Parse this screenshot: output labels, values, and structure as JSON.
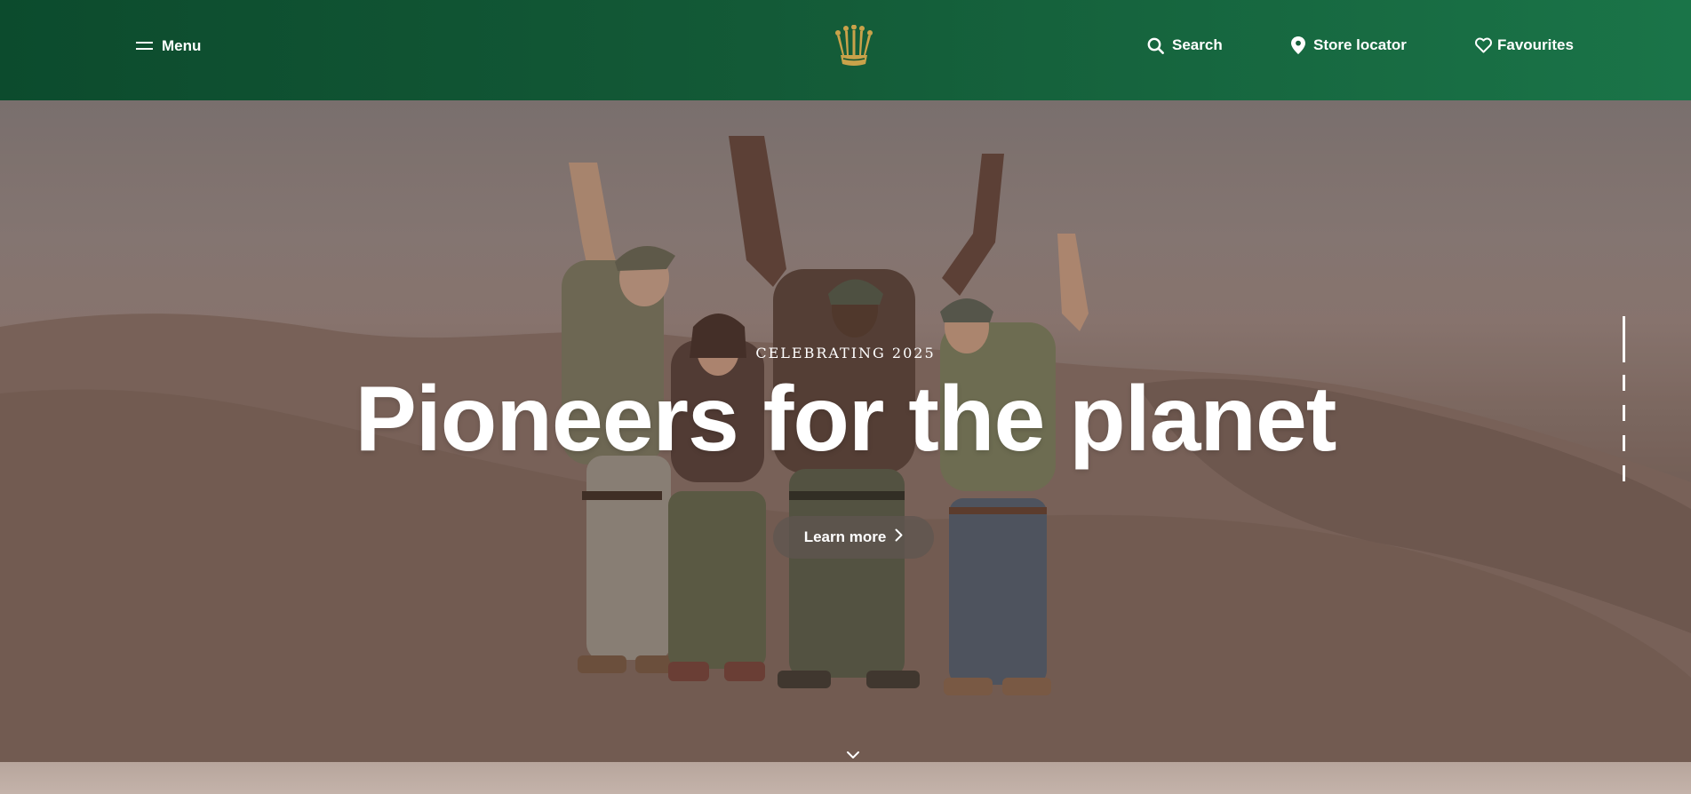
{
  "header": {
    "menu_label": "Menu",
    "logo_name": "crown-logo",
    "nav": {
      "search_label": "Search",
      "store_label": "Store locator",
      "favourites_label": "Favourites"
    }
  },
  "hero": {
    "eyebrow": "CELEBRATING 2025",
    "headline": "Pioneers for the planet",
    "cta_label": "Learn more",
    "slides_total": 5,
    "active_slide": 1
  },
  "colors": {
    "header_green_dark": "#0c4b2d",
    "header_green_light": "#1a7448",
    "logo_gold": "#c9a24a",
    "text": "#ffffff"
  },
  "icons": [
    "menu-icon",
    "crown-logo",
    "search-icon",
    "location-pin-icon",
    "heart-icon",
    "chevron-right-icon",
    "chevron-down-icon"
  ]
}
